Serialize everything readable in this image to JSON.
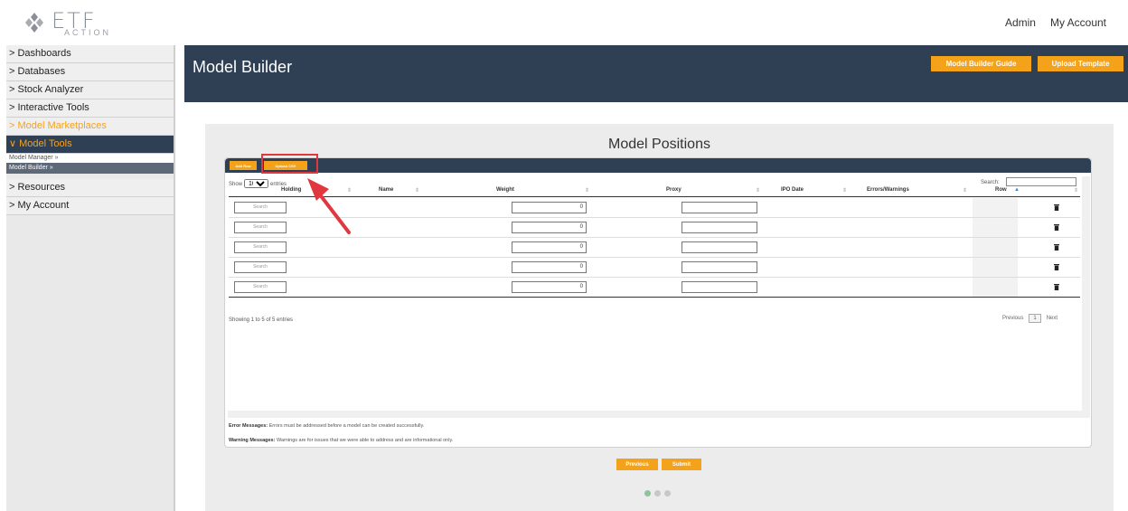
{
  "brand": {
    "name": "ETF",
    "tagline": "ACTION"
  },
  "top_links": {
    "admin": "Admin",
    "account": "My Account"
  },
  "sidebar": {
    "items": [
      {
        "label": "> Dashboards"
      },
      {
        "label": "> Databases"
      },
      {
        "label": "> Stock Analyzer"
      },
      {
        "label": "> Interactive Tools"
      },
      {
        "label": "> Model Marketplaces"
      },
      {
        "label": "∨ Model Tools"
      }
    ],
    "sub_items": [
      {
        "label": "Model Manager »"
      },
      {
        "label": "Model Builder »"
      }
    ],
    "bottom_items": [
      {
        "label": "> Resources"
      },
      {
        "label": "> My Account"
      }
    ]
  },
  "header": {
    "title": "Model Builder",
    "guide_button": "Model Builder Guide",
    "template_button": "Upload Template"
  },
  "card": {
    "title": "Model Positions"
  },
  "toolbar": {
    "add_row": "Add Row",
    "upload_csv": "Upload CSV"
  },
  "table_controls": {
    "show_label": "Show",
    "entries_value": "10",
    "entries_label": "entries",
    "search_label": "Search:"
  },
  "table": {
    "columns": [
      "Holding",
      "Name",
      "Weight",
      "Proxy",
      "IPO Date",
      "Errors/Warnings",
      "Row"
    ],
    "rows": [
      {
        "holding_placeholder": "Search",
        "weight": "0"
      },
      {
        "holding_placeholder": "Search",
        "weight": "0"
      },
      {
        "holding_placeholder": "Search",
        "weight": "0"
      },
      {
        "holding_placeholder": "Search",
        "weight": "0"
      },
      {
        "holding_placeholder": "Search",
        "weight": "0"
      }
    ],
    "info": "Showing 1 to 5 of 5 entries",
    "pager": {
      "previous": "Previous",
      "page": "1",
      "next": "Next"
    }
  },
  "messages": {
    "error_label": "Error Messages:",
    "error_text": "Errors must be addressed before a model can be created successfully.",
    "warning_label": "Warning Messages:",
    "warning_text": "Warnings are for issues that we were able to address and are informational only."
  },
  "footer_buttons": {
    "previous": "Previous",
    "submit": "Submit"
  },
  "colors": {
    "navy": "#2f4055",
    "orange": "#f5a21b",
    "highlight": "#e0383e",
    "step_active": "#8ec49c"
  }
}
